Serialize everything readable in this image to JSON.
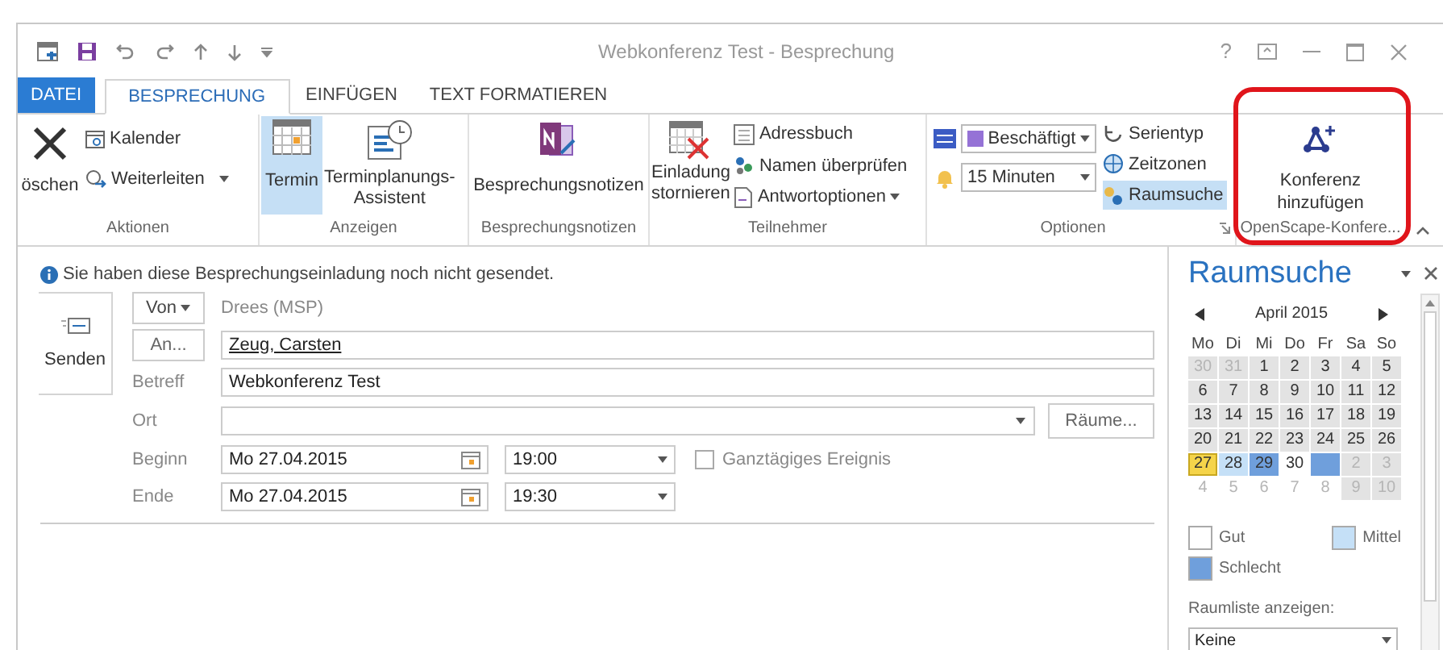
{
  "window": {
    "title": "Webkonferenz Test - Besprechung",
    "help": "?"
  },
  "tabs": [
    {
      "label": "DATEI",
      "kind": "file",
      "selected": false
    },
    {
      "label": "BESPRECHUNG",
      "kind": "tab",
      "selected": true
    },
    {
      "label": "EINFÜGEN",
      "kind": "tab",
      "selected": false
    },
    {
      "label": "TEXT FORMATIEREN",
      "kind": "tab",
      "selected": false
    }
  ],
  "ribbon": {
    "aktionen": {
      "label": "Aktionen",
      "delete": "öschen",
      "calendar": "Kalender",
      "forward": "Weiterleiten"
    },
    "anzeigen": {
      "label": "Anzeigen",
      "appointment": {
        "label": "Termin",
        "selected": true
      },
      "assistant": [
        "Terminplanungs-",
        "Assistent"
      ]
    },
    "notes": {
      "label": "Besprechungsnotizen",
      "button": "Besprechungsnotizen"
    },
    "teilnehmer": {
      "label": "Teilnehmer",
      "cancel": [
        "Einladung",
        "stornieren"
      ],
      "address_book": "Adressbuch",
      "check_names": "Namen überprüfen",
      "response": "Antwortoptionen"
    },
    "optionen": {
      "label": "Optionen",
      "show_as": "Beschäftigt",
      "reminder": "15 Minuten",
      "recurrence": "Serientyp",
      "time_zones": "Zeitzonen",
      "room_finder": {
        "label": "Raumsuche",
        "selected": true
      }
    },
    "openscape": {
      "label": "OpenScape-Konfere...",
      "button": [
        "Konferenz",
        "hinzufügen"
      ],
      "highlighted": true
    }
  },
  "info": "Sie haben diese Besprechungseinladung noch nicht gesendet.",
  "send": "Senden",
  "form": {
    "from_button": "Von",
    "from_value": "Drees (MSP)",
    "to_button": "An...",
    "to_value": "Zeug, Carsten",
    "subject_label": "Betreff",
    "subject": "Webkonferenz Test",
    "location_label": "Ort",
    "rooms_button": "Räume...",
    "start_label": "Beginn",
    "start_date": "Mo 27.04.2015",
    "start_time": "19:00",
    "all_day": {
      "label": "Ganztägiges Ereignis",
      "checked": false
    },
    "end_label": "Ende",
    "end_date": "Mo 27.04.2015",
    "end_time": "19:30"
  },
  "room_finder": {
    "title": "Raumsuche",
    "month": "April 2015",
    "weekdays": [
      "Mo",
      "Di",
      "Mi",
      "Do",
      "Fr",
      "Sa",
      "So"
    ],
    "weeks": [
      [
        {
          "day": "30",
          "muted": true,
          "color": "#e3e3e3",
          "selected": false
        },
        {
          "day": "31",
          "muted": true,
          "color": "#e3e3e3",
          "selected": false
        },
        {
          "day": "1",
          "muted": false,
          "color": "#e3e3e3",
          "selected": false
        },
        {
          "day": "2",
          "muted": false,
          "color": "#e3e3e3",
          "selected": false
        },
        {
          "day": "3",
          "muted": false,
          "color": "#e3e3e3",
          "selected": false
        },
        {
          "day": "4",
          "muted": false,
          "color": "#e3e3e3",
          "selected": false
        },
        {
          "day": "5",
          "muted": false,
          "color": "#e3e3e3",
          "selected": false
        }
      ],
      [
        {
          "day": "6",
          "muted": false,
          "color": "#e3e3e3",
          "selected": false
        },
        {
          "day": "7",
          "muted": false,
          "color": "#e3e3e3",
          "selected": false
        },
        {
          "day": "8",
          "muted": false,
          "color": "#e3e3e3",
          "selected": false
        },
        {
          "day": "9",
          "muted": false,
          "color": "#e3e3e3",
          "selected": false
        },
        {
          "day": "10",
          "muted": false,
          "color": "#e3e3e3",
          "selected": false
        },
        {
          "day": "11",
          "muted": false,
          "color": "#e3e3e3",
          "selected": false
        },
        {
          "day": "12",
          "muted": false,
          "color": "#e3e3e3",
          "selected": false
        }
      ],
      [
        {
          "day": "13",
          "muted": false,
          "color": "#e3e3e3",
          "selected": false
        },
        {
          "day": "14",
          "muted": false,
          "color": "#e3e3e3",
          "selected": false
        },
        {
          "day": "15",
          "muted": false,
          "color": "#e3e3e3",
          "selected": false
        },
        {
          "day": "16",
          "muted": false,
          "color": "#e3e3e3",
          "selected": false
        },
        {
          "day": "17",
          "muted": false,
          "color": "#e3e3e3",
          "selected": false
        },
        {
          "day": "18",
          "muted": false,
          "color": "#e3e3e3",
          "selected": false
        },
        {
          "day": "19",
          "muted": false,
          "color": "#e3e3e3",
          "selected": false
        }
      ],
      [
        {
          "day": "20",
          "muted": false,
          "color": "#e3e3e3",
          "selected": false
        },
        {
          "day": "21",
          "muted": false,
          "color": "#e3e3e3",
          "selected": false
        },
        {
          "day": "22",
          "muted": false,
          "color": "#e3e3e3",
          "selected": false
        },
        {
          "day": "23",
          "muted": false,
          "color": "#e3e3e3",
          "selected": false
        },
        {
          "day": "24",
          "muted": false,
          "color": "#e3e3e3",
          "selected": false
        },
        {
          "day": "25",
          "muted": false,
          "color": "#e3e3e3",
          "selected": false
        },
        {
          "day": "26",
          "muted": false,
          "color": "#e3e3e3",
          "selected": false
        }
      ],
      [
        {
          "day": "27",
          "muted": false,
          "color": "#f5d44a",
          "selected": true
        },
        {
          "day": "28",
          "muted": false,
          "color": "#c5e0f7",
          "selected": false
        },
        {
          "day": "29",
          "muted": false,
          "color": "#6f9fdc",
          "selected": false
        },
        {
          "day": "30",
          "muted": false,
          "color": "#ffffff",
          "selected": false
        },
        {
          "color": "#6f9fdc",
          "selected": false
        },
        {
          "day": "2",
          "muted": true,
          "color": "#e3e3e3",
          "selected": false
        },
        {
          "day": "3",
          "muted": true,
          "color": "#e3e3e3",
          "selected": false
        }
      ],
      [
        {
          "day": "4",
          "muted": true,
          "color": "#ffffff",
          "selected": false
        },
        {
          "day": "5",
          "muted": true,
          "color": "#ffffff",
          "selected": false
        },
        {
          "day": "6",
          "muted": true,
          "color": "#ffffff",
          "selected": false
        },
        {
          "day": "7",
          "muted": true,
          "color": "#ffffff",
          "selected": false
        },
        {
          "day": "8",
          "muted": true,
          "color": "#ffffff",
          "selected": false
        },
        {
          "day": "9",
          "muted": true,
          "color": "#e3e3e3",
          "selected": false
        },
        {
          "day": "10",
          "muted": true,
          "color": "#e3e3e3",
          "selected": false
        }
      ]
    ],
    "legend": [
      {
        "label": "Gut",
        "color": "#ffffff"
      },
      {
        "label": "Mittel",
        "color": "#c5e0f7"
      },
      {
        "label": "Schlecht",
        "color": "#6f9fdc"
      }
    ],
    "list_label": "Raumliste anzeigen:",
    "list_value": "Keine"
  }
}
